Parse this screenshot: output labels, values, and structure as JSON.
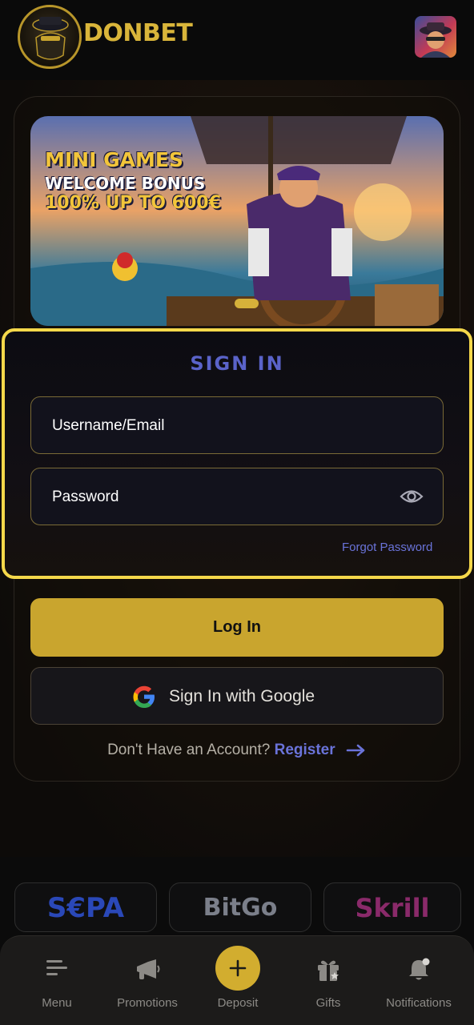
{
  "header": {
    "brand": "DONBET",
    "logo_icon": "gangster-logo-icon",
    "avatar_icon": "user-avatar"
  },
  "banner": {
    "line1": "MINI GAMES",
    "line2": "WELCOME BONUS",
    "line3": "100% UP TO 600€",
    "slide_count": 1,
    "active_slide": 1
  },
  "signin": {
    "title": "SIGN IN",
    "username_placeholder": "Username/Email",
    "password_placeholder": "Password",
    "forgot_label": "Forgot Password"
  },
  "actions": {
    "login_label": "Log In",
    "google_label": "Sign In with Google",
    "no_account_text": "Don't Have an Account?",
    "register_label": "Register"
  },
  "payments": [
    "S€PA",
    "BitGo",
    "Skrill"
  ],
  "nav": {
    "menu": "Menu",
    "promotions": "Promotions",
    "deposit": "Deposit",
    "gifts": "Gifts",
    "notifications": "Notifications"
  },
  "colors": {
    "accent_gold": "#c9a52e",
    "link_blue": "#6a73d9",
    "highlight_yellow": "#f5d84a"
  }
}
